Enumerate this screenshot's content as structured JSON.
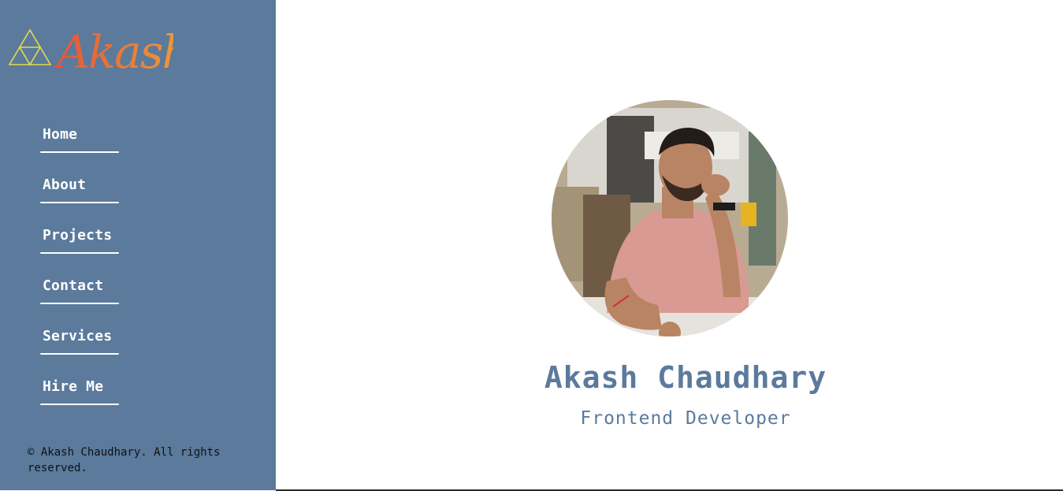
{
  "brand": {
    "logo_text": "Akash",
    "logo_icon": "triforce-icon",
    "colors": {
      "icon": "#e8d84a",
      "text_start": "#e2533a",
      "text_end": "#f0a035"
    }
  },
  "sidebar": {
    "background": "#5b7a9c",
    "items": [
      {
        "label": "Home"
      },
      {
        "label": "About"
      },
      {
        "label": "Projects"
      },
      {
        "label": "Contact"
      },
      {
        "label": "Services"
      },
      {
        "label": "Hire Me"
      }
    ],
    "footer": "© Akash Chaudhary. All rights reserved."
  },
  "profile": {
    "name": "Akash Chaudhary",
    "title": "Frontend Developer",
    "photo": "profile-photo",
    "accent": "#5b7a9c"
  }
}
